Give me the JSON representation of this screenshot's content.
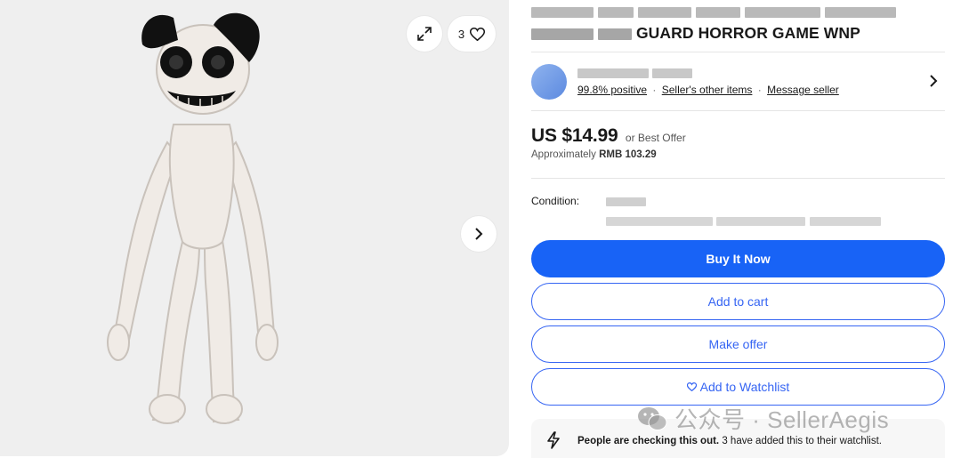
{
  "gallery": {
    "watch_count": "3",
    "image_alt": "Plush toy photo"
  },
  "listing": {
    "title_visible": "GUARD HORROR GAME WNP"
  },
  "seller": {
    "feedback": "99.8% positive",
    "other_items": "Seller's other items",
    "message": "Message seller",
    "separator": "·"
  },
  "price": {
    "main": "US $14.99",
    "best_offer": "or Best Offer",
    "approx_prefix": "Approximately",
    "approx_value": "RMB 103.29"
  },
  "condition": {
    "label": "Condition:"
  },
  "actions": {
    "buy_now": "Buy It Now",
    "add_to_cart": "Add to cart",
    "make_offer": "Make offer",
    "add_watchlist": "Add to Watchlist"
  },
  "signal": {
    "bold": "People are checking this out.",
    "rest": "3 have added this to their watchlist."
  },
  "watermark": {
    "text": "公众号 · SellerAegis"
  },
  "colors": {
    "accent": "#3665f3",
    "primary_button": "#1863f6",
    "gallery_bg": "#efefef"
  }
}
